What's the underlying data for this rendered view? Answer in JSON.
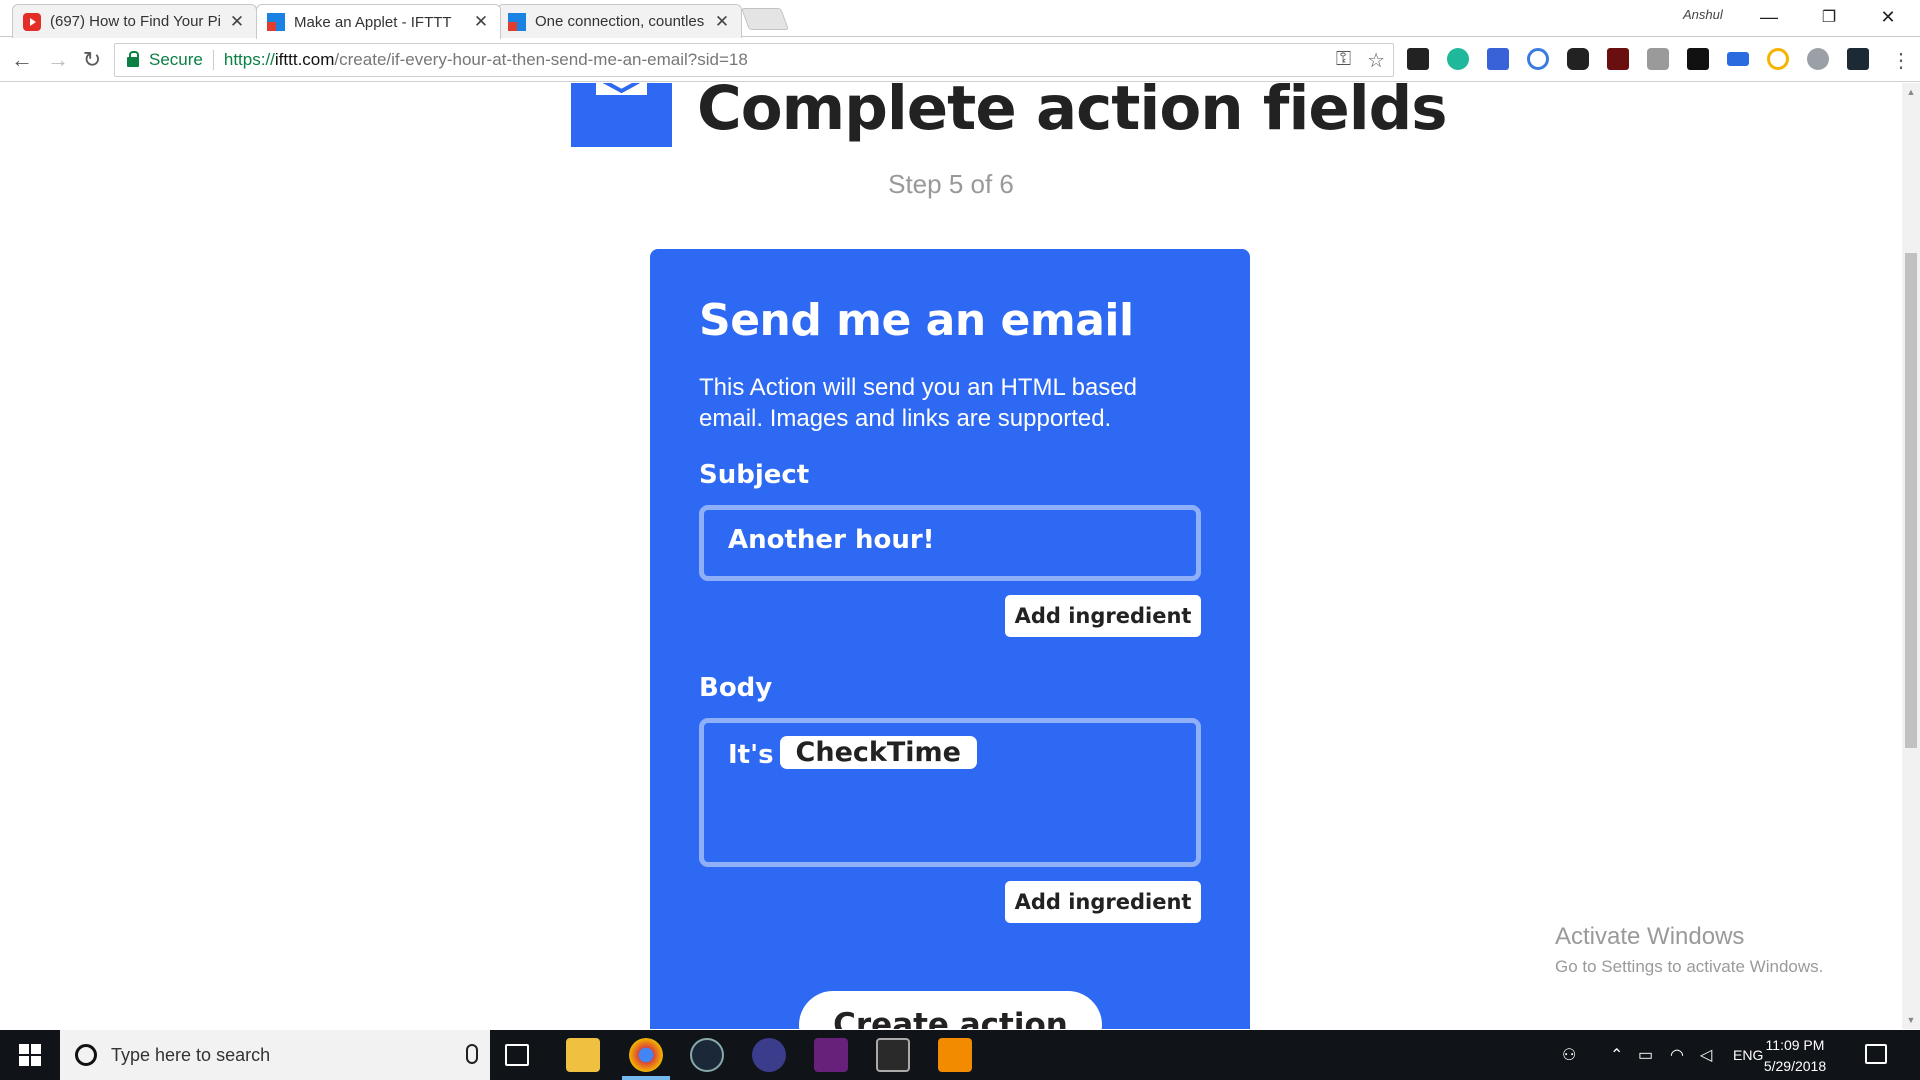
{
  "browser": {
    "tabs": [
      {
        "title": "(697) How to Find Your Pi",
        "icon": "youtube-icon",
        "active": false
      },
      {
        "title": "Make an Applet - IFTTT",
        "icon": "ifttt-icon",
        "active": true
      },
      {
        "title": "One connection, countles",
        "icon": "ifttt-icon",
        "active": false
      }
    ],
    "profile_name": "Anshul",
    "window_controls": {
      "minimize": "—",
      "restore": "❐",
      "close": "✕"
    },
    "nav": {
      "back": "←",
      "forward": "→",
      "reload": "↻"
    },
    "security_label": "Secure",
    "url": {
      "scheme": "https://",
      "host": "ifttt.com",
      "path": "/create/if-every-hour-at-then-send-me-an-email?sid=18"
    },
    "omnibox_icons": {
      "key": "⚿",
      "star": "☆"
    },
    "menu_glyph": "⋮"
  },
  "page": {
    "title": "Complete action fields",
    "step": "Step 5 of 6",
    "action_card": {
      "title": "Send me an email",
      "description": "This Action will send you an HTML based email. Images and links are supported.",
      "subject_label": "Subject",
      "subject_value": "Another hour!",
      "body_label": "Body",
      "body_prefix": "It's",
      "body_ingredient": "CheckTime",
      "add_ingredient_label": "Add ingredient",
      "create_button_label": "Create action"
    },
    "colors": {
      "brand_blue": "#2d69f2",
      "field_border": "#8fb0f9"
    }
  },
  "watermark": {
    "line1": "Activate Windows",
    "line2": "Go to Settings to activate Windows."
  },
  "taskbar": {
    "search_placeholder": "Type here to search",
    "language": "ENG",
    "time": "11:09 PM",
    "date": "5/29/2018"
  }
}
